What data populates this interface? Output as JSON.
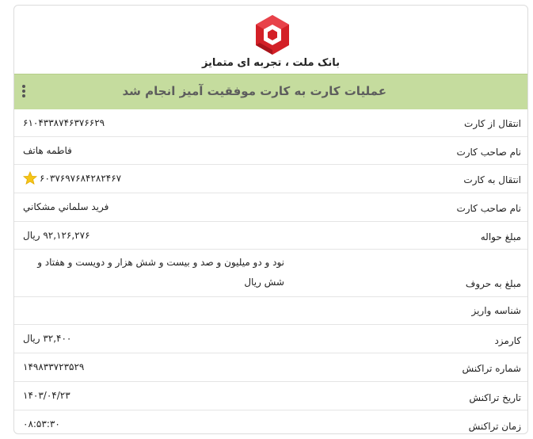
{
  "bank": {
    "name": "بانک ملت ، تجربه ای متمایز",
    "logo_color": "#d32027"
  },
  "header": {
    "title": "عملیات کارت به کارت موفقیت آمیز انجام شد",
    "bg_color": "#c5dc9e",
    "menu_icon": "kebab-menu-icon"
  },
  "details": [
    {
      "label": "انتقال از کارت",
      "value": "۶۱۰۴۳۳۸۷۴۶۳۷۶۶۲۹"
    },
    {
      "label": "نام صاحب کارت",
      "value": "فاطمه هاتف"
    },
    {
      "label": "انتقال به کارت",
      "value": "۶۰۳۷۶۹۷۶۸۴۲۸۲۴۶۷",
      "icon": "star-icon"
    },
    {
      "label": "نام صاحب کارت",
      "value": "فريد سلماني مشكاني"
    },
    {
      "label": "مبلغ حواله",
      "value": "۹۲,۱۲۶,۲۷۶ ریال"
    },
    {
      "label": "مبلغ به حروف",
      "value": "نود و دو میلیون و صد و بیست و شش هزار و دویست و هفتاد و شش ریال"
    },
    {
      "label": "شناسه واریز",
      "value": ""
    },
    {
      "label": "کارمزد",
      "value": "۳۲,۴۰۰ ریال"
    },
    {
      "label": "شماره تراکنش",
      "value": "۱۴۹۸۳۳۷۲۳۵۲۹"
    },
    {
      "label": "تاریخ تراکنش",
      "value": "۱۴۰۳/۰۴/۲۳"
    },
    {
      "label": "زمان تراکنش",
      "value": "۰۸:۵۳:۳۰"
    }
  ]
}
